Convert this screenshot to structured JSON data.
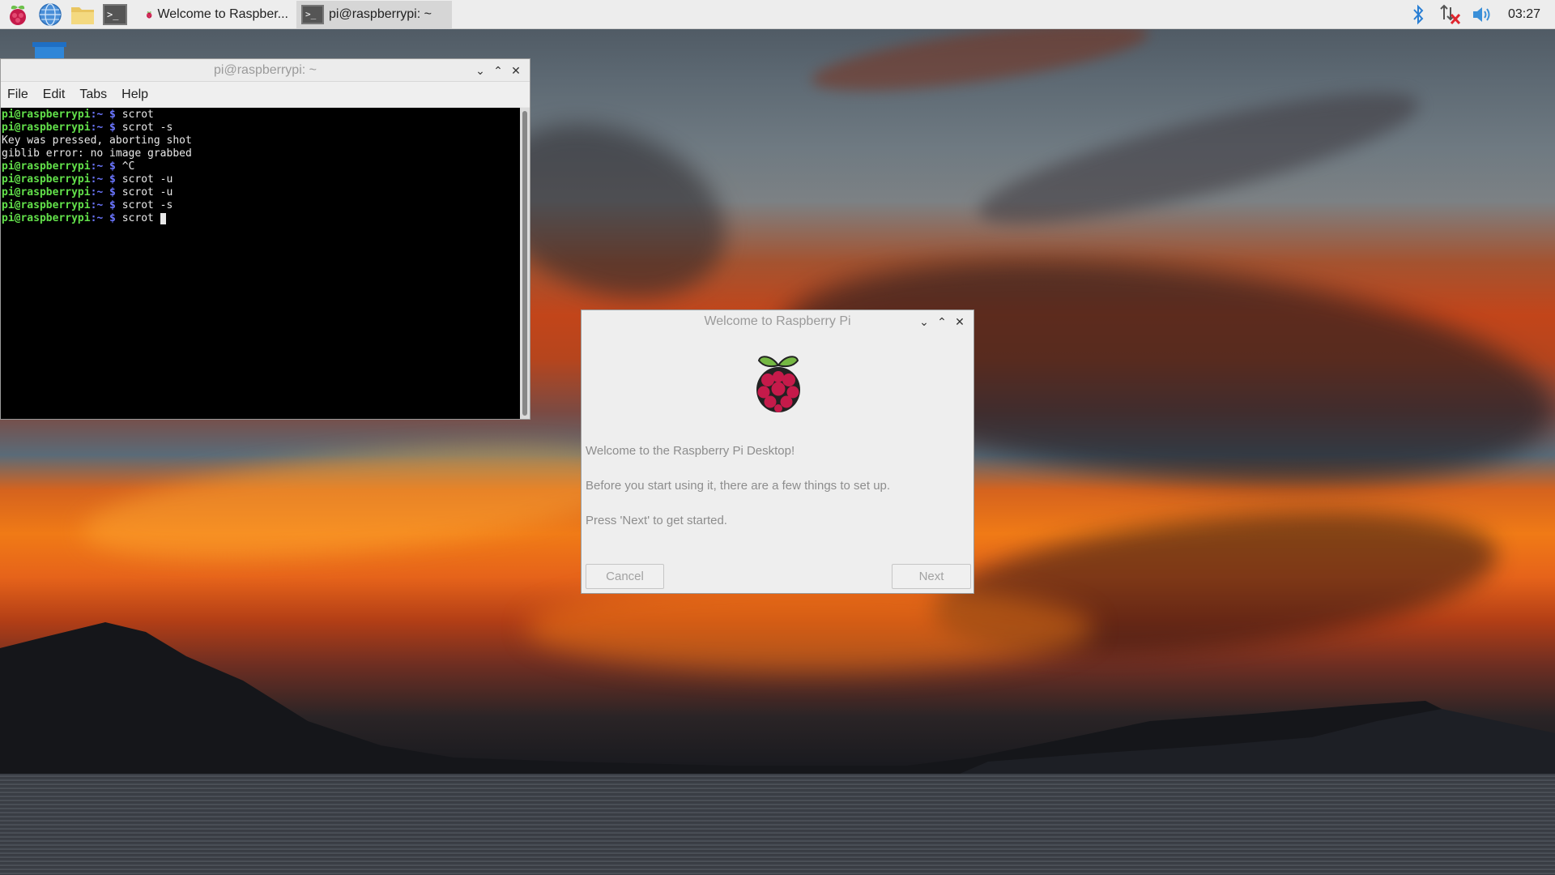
{
  "taskbar": {
    "launchers": [
      {
        "icon": "raspberry-menu-icon"
      },
      {
        "icon": "web-browser-icon"
      },
      {
        "icon": "file-manager-icon"
      },
      {
        "icon": "terminal-icon"
      }
    ],
    "tasks": [
      {
        "label": "Welcome to Raspber...",
        "icon": "raspberry-icon"
      },
      {
        "label": "pi@raspberrypi: ~",
        "icon": "terminal-icon"
      }
    ],
    "tray": {
      "icons": [
        "bluetooth-icon",
        "network-disconnected-icon",
        "volume-icon"
      ],
      "clock": "03:27"
    }
  },
  "terminal": {
    "title": "pi@raspberrypi: ~",
    "menu": [
      "File",
      "Edit",
      "Tabs",
      "Help"
    ],
    "prompt_user": "pi@raspberrypi",
    "prompt_path": ":~ $",
    "lines": [
      {
        "type": "cmd",
        "text": " scrot"
      },
      {
        "type": "cmd",
        "text": " scrot -s"
      },
      {
        "type": "out",
        "text": "Key was pressed, aborting shot"
      },
      {
        "type": "out",
        "text": "giblib error: no image grabbed"
      },
      {
        "type": "cmd",
        "text": " ^C"
      },
      {
        "type": "cmd",
        "text": " scrot -u"
      },
      {
        "type": "cmd",
        "text": " scrot -u"
      },
      {
        "type": "cmd",
        "text": " scrot -s"
      },
      {
        "type": "cmd",
        "text": " scrot "
      }
    ]
  },
  "welcome": {
    "title": "Welcome to Raspberry Pi",
    "line1": "Welcome to the Raspberry Pi Desktop!",
    "line2": "Before you start using it, there are a few things to set up.",
    "line3": "Press 'Next' to get started.",
    "cancel_label": "Cancel",
    "next_label": "Next"
  },
  "window_controls": {
    "minimize": "⌄",
    "maximize": "⌃",
    "close": "✕"
  },
  "colors": {
    "prompt_user": "#62e04a",
    "prompt_path": "#6b76ff",
    "panel_bg": "#ededed"
  }
}
